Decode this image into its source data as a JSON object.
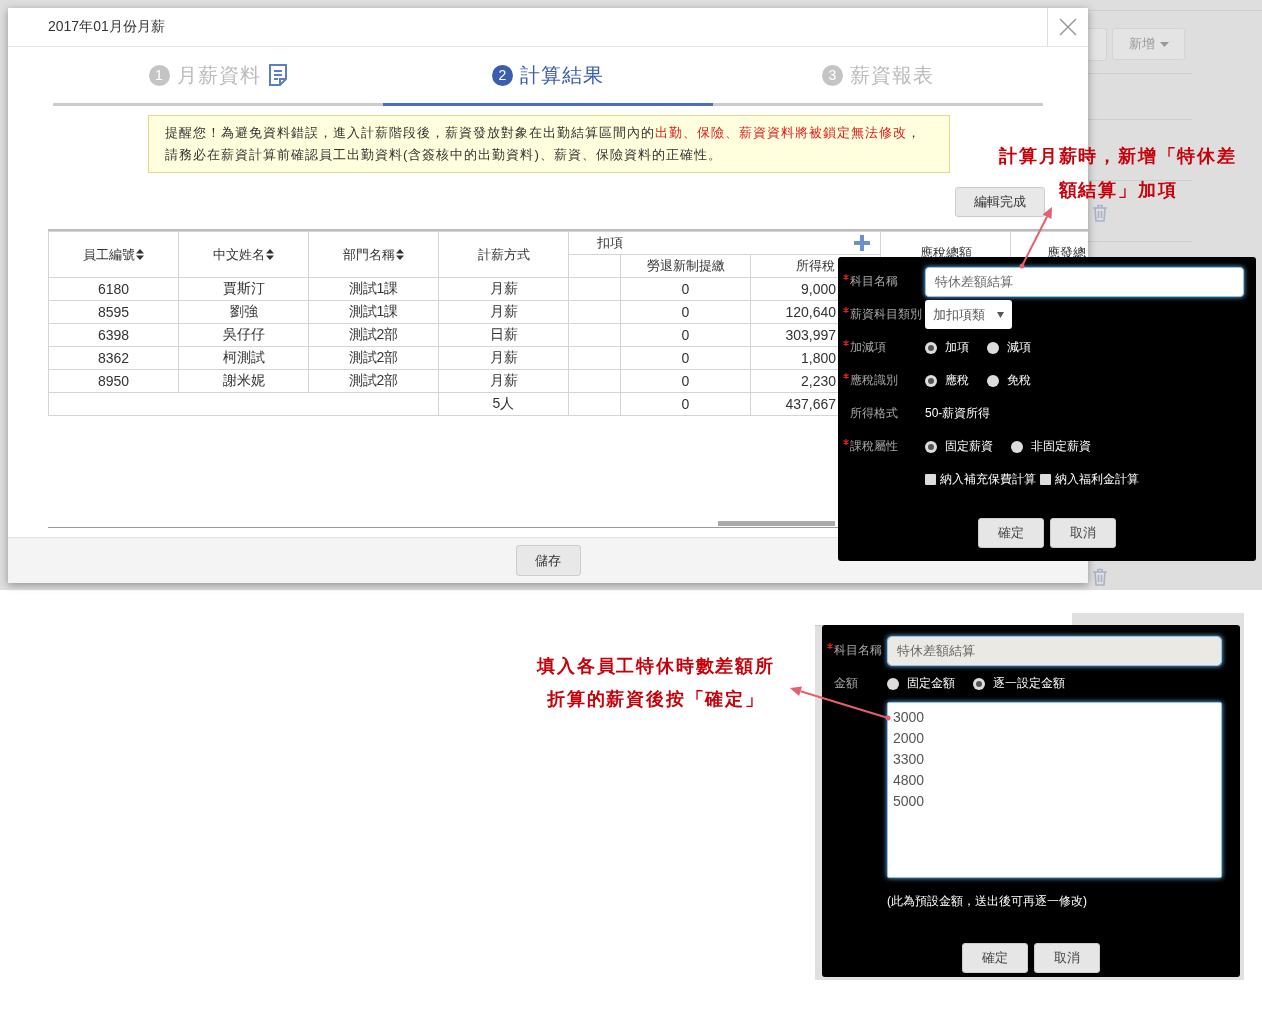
{
  "background": {
    "buttons": [
      {
        "label": "新增",
        "dropdown": true
      }
    ]
  },
  "modal": {
    "title": "2017年01月份月薪",
    "steps": [
      {
        "number": "1",
        "label": "月薪資料",
        "selected": false,
        "icon": true
      },
      {
        "number": "2",
        "label": "計算結果",
        "selected": true,
        "icon": false
      },
      {
        "number": "3",
        "label": "薪資報表",
        "selected": false,
        "icon": false
      }
    ],
    "notice": [
      {
        "text": "提醒您！為避免資料錯誤，進入計薪階段後，薪資發放對象在出勤結算區間內的",
        "highlight": false
      },
      {
        "text": "出勤、保險、薪資資料將被鎖定無法修改",
        "highlight": true
      },
      {
        "text": "，請務必在薪資計算前確認員工出勤資料(含簽核中的出勤資料)、薪資、保險資料的正確性。",
        "highlight": false
      }
    ],
    "edit_button": "編輯完成",
    "table": {
      "columns": [
        {
          "label": "員工編號",
          "sortable": true
        },
        {
          "label": "中文姓名",
          "sortable": true
        },
        {
          "label": "部門名稱",
          "sortable": true
        },
        {
          "label": "計薪方式",
          "sortable": false
        }
      ],
      "deductions": {
        "label": "扣項",
        "columns": [
          "勞退新制提繳",
          "所得稅"
        ]
      },
      "trailing_columns": [
        "應稅總額",
        "應發總"
      ],
      "rows": [
        {
          "cells": [
            "6180",
            "賈斯汀",
            "測試1課",
            "月薪"
          ],
          "deductions": [
            "0",
            "9,000"
          ]
        },
        {
          "cells": [
            "8595",
            "劉強",
            "測試1課",
            "月薪"
          ],
          "deductions": [
            "0",
            "120,640"
          ]
        },
        {
          "cells": [
            "6398",
            "吳仔仔",
            "測試2部",
            "日薪"
          ],
          "deductions": [
            "0",
            "303,997"
          ]
        },
        {
          "cells": [
            "8362",
            "柯測試",
            "測試2部",
            "月薪"
          ],
          "deductions": [
            "0",
            "1,800"
          ]
        },
        {
          "cells": [
            "8950",
            "謝米妮",
            "測試2部",
            "月薪"
          ],
          "deductions": [
            "0",
            "2,230"
          ]
        }
      ],
      "total": {
        "count": "5人",
        "deductions": [
          "0",
          "437,667"
        ]
      }
    },
    "save_button": "儲存"
  },
  "item_popovers": [
    {
      "rows": [
        {
          "kind": "text",
          "label": "科目名稱",
          "required": true,
          "value": "特休差額結算",
          "readonly": false
        },
        {
          "kind": "select",
          "label": "薪資科目類別",
          "required": true,
          "value": "加扣項類"
        },
        {
          "kind": "radio",
          "label": "加減項",
          "required": true,
          "options": [
            {
              "label": "加項",
              "checked": true
            },
            {
              "label": "減項",
              "checked": false
            }
          ]
        },
        {
          "kind": "radio",
          "label": "應稅識別",
          "required": true,
          "options": [
            {
              "label": "應稅",
              "checked": true
            },
            {
              "label": "免稅",
              "checked": false
            }
          ]
        },
        {
          "kind": "value",
          "label": "所得格式",
          "required": false,
          "value": "50-薪資所得"
        },
        {
          "kind": "radio",
          "label": "課稅屬性",
          "required": true,
          "options": [
            {
              "label": "固定薪資",
              "checked": true
            },
            {
              "label": "非固定薪資",
              "checked": false
            }
          ]
        },
        {
          "kind": "checkbox",
          "options": [
            {
              "label": "納入補充保費計算",
              "checked": false
            },
            {
              "label": "納入福利金計算",
              "checked": false
            }
          ]
        }
      ],
      "buttons": [
        "確定",
        "取消"
      ]
    },
    {
      "rows": [
        {
          "kind": "text",
          "label": "科目名稱",
          "required": true,
          "value": "特休差額結算",
          "readonly": true
        },
        {
          "kind": "radio",
          "label": "金額",
          "required": false,
          "options": [
            {
              "label": "固定金額",
              "checked": false
            },
            {
              "label": "逐一設定金額",
              "checked": true
            }
          ]
        },
        {
          "kind": "textarea",
          "value": "3000\n2000\n3300\n4800\n5000"
        },
        {
          "kind": "note",
          "text": "(此為預設金額，送出後可再逐一修改)"
        }
      ],
      "buttons": [
        "確定",
        "取消"
      ]
    }
  ],
  "callouts": [
    {
      "lines": [
        "計算月薪時，新增「特休差",
        "額結算」加項"
      ]
    },
    {
      "lines": [
        "填入各員工特休時數差額所",
        "折算的薪資後按「確定」"
      ]
    }
  ]
}
